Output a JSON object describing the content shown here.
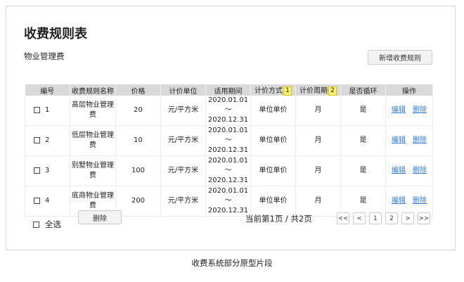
{
  "page": {
    "title": "收费规则表",
    "section": "物业管理费",
    "add_button": "新增收费规则"
  },
  "table": {
    "headers": [
      "编号",
      "收费规则名称",
      "价格",
      "计价单位",
      "适用期间",
      "计价方式",
      "计价周期",
      "是否循环",
      "操作"
    ],
    "header_tags": {
      "pricing_method": "1",
      "pricing_period": "2"
    },
    "rows": [
      {
        "no": "1",
        "name": "高层物业管理费",
        "price": "20",
        "unit": "元/平方米",
        "period": "2020.01.01～2020.12.31",
        "method": "单位单价",
        "cycle": "月",
        "recurring": "是",
        "edit": "编辑",
        "delete": "删除"
      },
      {
        "no": "2",
        "name": "低层物业管理费",
        "price": "10",
        "unit": "元/平方米",
        "period": "2020.01.01～2020.12.31",
        "method": "单位单价",
        "cycle": "月",
        "recurring": "是",
        "edit": "编辑",
        "delete": "删除"
      },
      {
        "no": "3",
        "name": "别墅物业管理费",
        "price": "100",
        "unit": "元/平方米",
        "period": "2020.01.01～2020.12.31",
        "method": "单位单价",
        "cycle": "月",
        "recurring": "是",
        "edit": "编辑",
        "delete": "删除"
      },
      {
        "no": "4",
        "name": "底商物业管理费",
        "price": "200",
        "unit": "元/平方米",
        "period": "2020.01.01～2020.12.31",
        "method": "单位单价",
        "cycle": "月",
        "recurring": "是",
        "edit": "编辑",
        "delete": "删除"
      }
    ]
  },
  "footer": {
    "select_all": "全选",
    "delete_button": "删除",
    "page_info": "当前第1页 / 共2页",
    "pager": [
      "<<",
      "<",
      "1",
      "2",
      ">",
      ">>"
    ]
  },
  "caption": "收费系统部分原型片段"
}
